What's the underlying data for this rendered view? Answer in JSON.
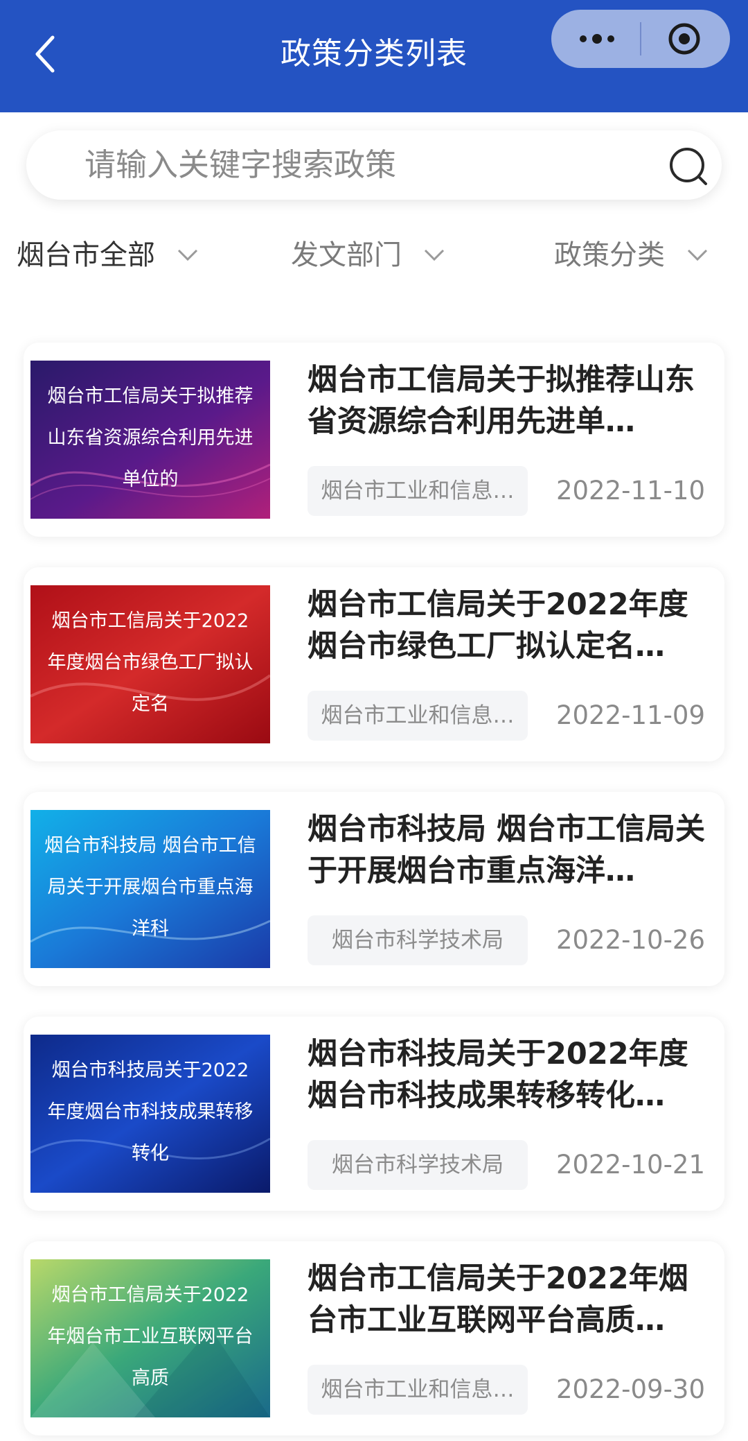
{
  "header": {
    "title": "政策分类列表"
  },
  "search": {
    "placeholder": "请输入关键字搜索政策"
  },
  "filters": [
    {
      "label": "烟台市全部"
    },
    {
      "label": "发文部门"
    },
    {
      "label": "政策分类"
    }
  ],
  "policies": [
    {
      "thumb_text": "烟台市工信局关于拟推荐山东省资源综合利用先进单位的",
      "title": "烟台市工信局关于拟推荐山东省资源综合利用先进单…",
      "department": "烟台市工业和信息…",
      "date": "2022-11-10"
    },
    {
      "thumb_text": "烟台市工信局关于2022年度烟台市绿色工厂拟认定名",
      "title": "烟台市工信局关于2022年度烟台市绿色工厂拟认定名…",
      "department": "烟台市工业和信息…",
      "date": "2022-11-09"
    },
    {
      "thumb_text": "烟台市科技局 烟台市工信局关于开展烟台市重点海洋科",
      "title": "烟台市科技局 烟台市工信局关于开展烟台市重点海洋…",
      "department": "烟台市科学技术局",
      "date": "2022-10-26"
    },
    {
      "thumb_text": "烟台市科技局关于2022年度烟台市科技成果转移转化",
      "title": "烟台市科技局关于2022年度烟台市科技成果转移转化…",
      "department": "烟台市科学技术局",
      "date": "2022-10-21"
    },
    {
      "thumb_text": "烟台市工信局关于2022年烟台市工业互联网平台高质",
      "title": "烟台市工信局关于2022年烟台市工业互联网平台高质…",
      "department": "烟台市工业和信息…",
      "date": "2022-09-30"
    }
  ],
  "colors": {
    "header_bg": "#2453c2"
  },
  "icons": [
    "chevron-left-icon",
    "more-icon",
    "target-icon",
    "search-icon",
    "chevron-down-icon"
  ]
}
